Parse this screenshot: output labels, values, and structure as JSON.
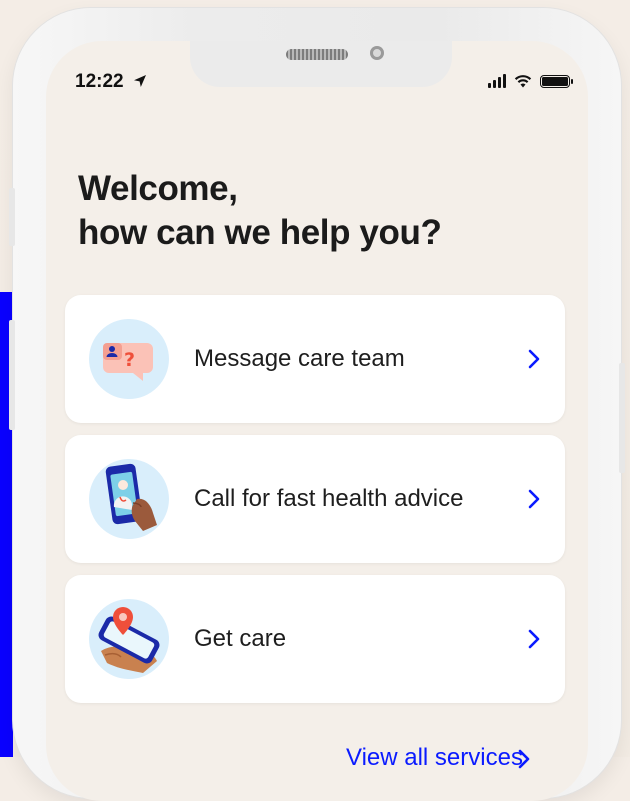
{
  "status_bar": {
    "time": "12:22",
    "location_icon": "location-arrow-icon",
    "signal_icon": "cellular-signal-icon",
    "wifi_icon": "wifi-icon",
    "battery_icon": "battery-icon"
  },
  "heading": {
    "line1": "Welcome,",
    "line2": "how can we help you?"
  },
  "cards": [
    {
      "label": "Message care team",
      "icon": "message-bubble-icon"
    },
    {
      "label": "Call for fast health advice",
      "icon": "phone-doctor-icon"
    },
    {
      "label": "Get care",
      "icon": "map-pin-phone-icon"
    }
  ],
  "view_all": {
    "label": "View all services"
  },
  "colors": {
    "background": "#f4efe9",
    "card": "#ffffff",
    "accent": "#0a1bff",
    "icon_bg": "#d9eefb",
    "heading": "#1b1b1b"
  }
}
